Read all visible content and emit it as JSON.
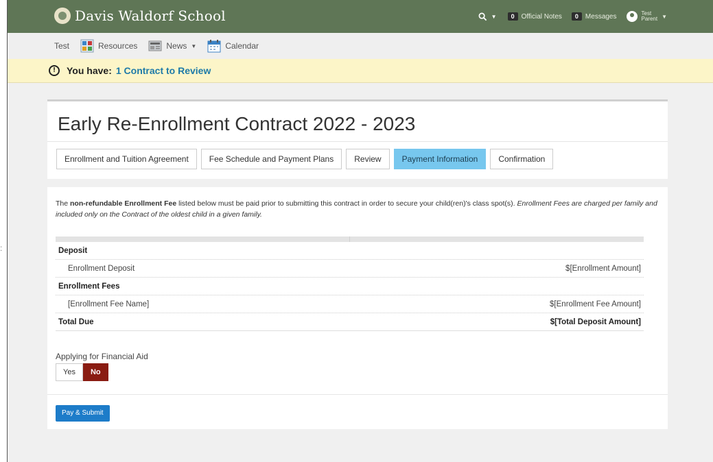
{
  "app": {
    "school_name": "Davis Waldorf School"
  },
  "topbar": {
    "official_notes_count": "0",
    "official_notes_label": "Official Notes",
    "messages_count": "0",
    "messages_label": "Messages",
    "user_first": "Test",
    "user_last": "Parent"
  },
  "nav": {
    "test_label": "Test",
    "resources_label": "Resources",
    "news_label": "News",
    "calendar_label": "Calendar"
  },
  "notice": {
    "prefix": "You have:",
    "link": "1 Contract to Review"
  },
  "contract": {
    "title": "Early Re-Enrollment Contract 2022 - 2023",
    "tabs": [
      {
        "label": "Enrollment and Tuition Agreement",
        "active": false
      },
      {
        "label": "Fee Schedule and Payment Plans",
        "active": false
      },
      {
        "label": "Review",
        "active": false
      },
      {
        "label": "Payment Information",
        "active": true
      },
      {
        "label": "Confirmation",
        "active": false
      }
    ]
  },
  "payment": {
    "intro_the": "The",
    "intro_bold": "non-refundable Enrollment Fee",
    "intro_rest": "listed below must be paid prior to submitting this contract in order to secure your child(ren)'s class spot(s).",
    "intro_italic": "Enrollment Fees are charged per family and included only on the Contract of the oldest child in a given family.",
    "rows": [
      {
        "label": "Deposit",
        "value": "",
        "kind": "section"
      },
      {
        "label": "Enrollment Deposit",
        "value": "$[Enrollment Amount]",
        "kind": "item"
      },
      {
        "label": "Enrollment Fees",
        "value": "",
        "kind": "section"
      },
      {
        "label": "[Enrollment Fee Name]",
        "value": "$[Enrollment Fee Amount]",
        "kind": "item"
      },
      {
        "label": "Total Due",
        "value": "$[Total Deposit Amount]",
        "kind": "total"
      }
    ],
    "financial_aid_label": "Applying for Financial Aid",
    "financial_aid_yes": "Yes",
    "financial_aid_no": "No",
    "financial_aid_selected": "No",
    "submit_label": "Pay & Submit"
  },
  "colors": {
    "topbar": "#5f7656",
    "active_tab": "#77c7ee",
    "no_selected": "#8a1c12",
    "submit": "#1d7cc9",
    "notice_bg": "#fcf5c8"
  }
}
